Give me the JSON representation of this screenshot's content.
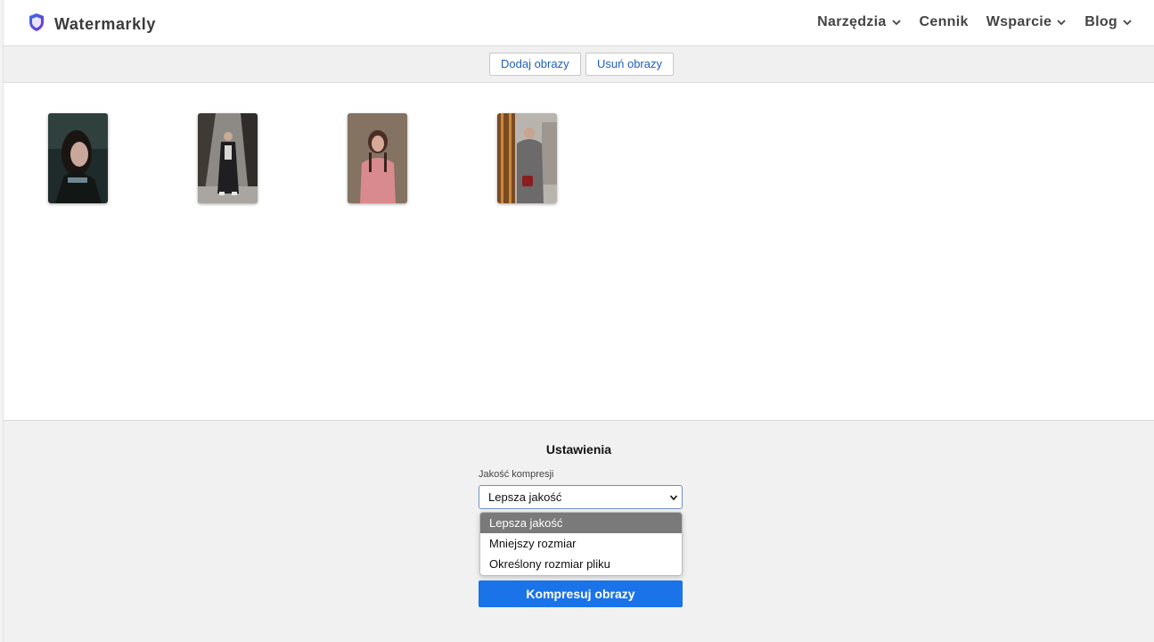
{
  "header": {
    "brand_name": "Watermarkly",
    "nav": [
      {
        "label": "Narzędzia",
        "has_dropdown": true
      },
      {
        "label": "Cennik",
        "has_dropdown": false
      },
      {
        "label": "Wsparcie",
        "has_dropdown": true
      },
      {
        "label": "Blog",
        "has_dropdown": true
      }
    ]
  },
  "toolbar": {
    "add_label": "Dodaj obrazy",
    "remove_label": "Usuń obrazy"
  },
  "gallery": {
    "images": [
      {
        "name": "photo-woman-dark-hair"
      },
      {
        "name": "photo-woman-long-coat"
      },
      {
        "name": "photo-woman-pink-jacket"
      },
      {
        "name": "photo-woman-window-scarf"
      }
    ]
  },
  "settings": {
    "title": "Ustawienia",
    "quality_label": "Jakość kompresji",
    "quality_selected": "Lepsza jakość",
    "quality_options": [
      "Lepsza jakość",
      "Mniejszy rozmiar",
      "Określony rozmiar pliku"
    ],
    "compress_label": "Kompresuj obrazy"
  },
  "colors": {
    "accent": "#1a73e8",
    "link": "#1f5fbf",
    "brand_shield": "#5b3fd6"
  }
}
